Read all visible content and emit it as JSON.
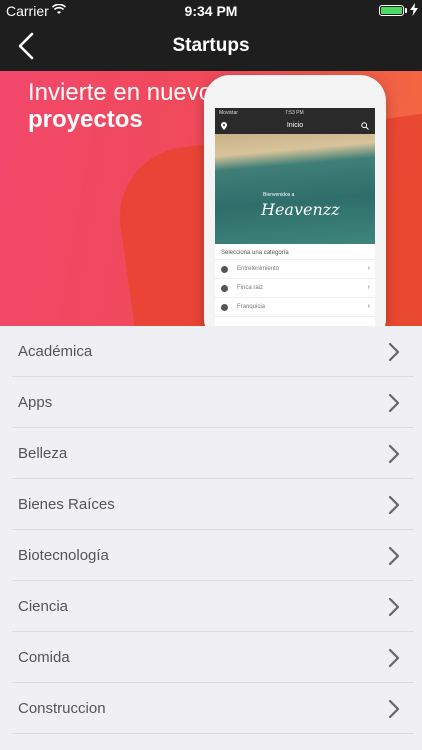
{
  "status_bar": {
    "carrier": "Carrier",
    "time": "9:34 PM",
    "icons": [
      "wifi-icon",
      "battery-icon",
      "charging-icon"
    ]
  },
  "nav": {
    "title": "Startups",
    "back_icon": "chevron-left-icon"
  },
  "banner": {
    "headline_line1": "Invierte en nuevos",
    "headline_line2": "proyectos",
    "phone": {
      "carrier": "Movistar",
      "time": "7:53 PM",
      "nav_title": "Inicio",
      "hero_small_text": "Bienvenidos a",
      "hero_brand": "Heavenzz",
      "category_title": "Selecciona una categoría",
      "categories": [
        "Entretenimiento",
        "Finca raiz",
        "Franquicia"
      ]
    }
  },
  "categories": [
    {
      "label": "Académica"
    },
    {
      "label": "Apps"
    },
    {
      "label": "Belleza"
    },
    {
      "label": "Bienes Raíces"
    },
    {
      "label": "Biotecnología"
    },
    {
      "label": "Ciencia"
    },
    {
      "label": "Comida"
    },
    {
      "label": "Construccion"
    }
  ],
  "colors": {
    "nav_background": "#1e1e1e",
    "banner_start": "#f2476b",
    "banner_end": "#f26a3c",
    "list_background": "#efeff4",
    "battery": "#4cd964"
  }
}
